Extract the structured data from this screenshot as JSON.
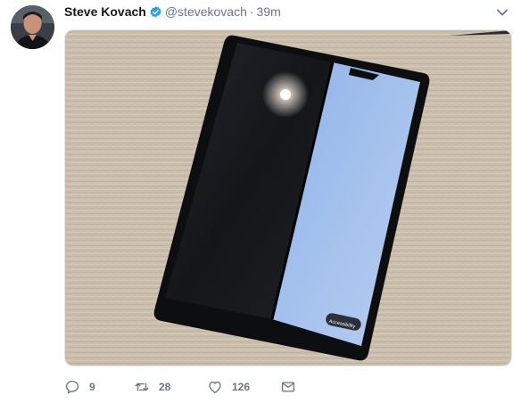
{
  "tweet": {
    "display_name": "Steve Kovach",
    "handle": "@stevekovach",
    "separator": "·",
    "time": "39m",
    "verified_icon": "verified-badge-icon",
    "menu_icon": "chevron-down-icon",
    "media": {
      "screen_label": "Accessibility"
    },
    "actions": {
      "reply_count": "9",
      "retweet_count": "28",
      "like_count": "126"
    },
    "colors": {
      "verified_blue": "#1da1f2",
      "muted_text": "#657786",
      "name_text": "#14171a"
    }
  }
}
